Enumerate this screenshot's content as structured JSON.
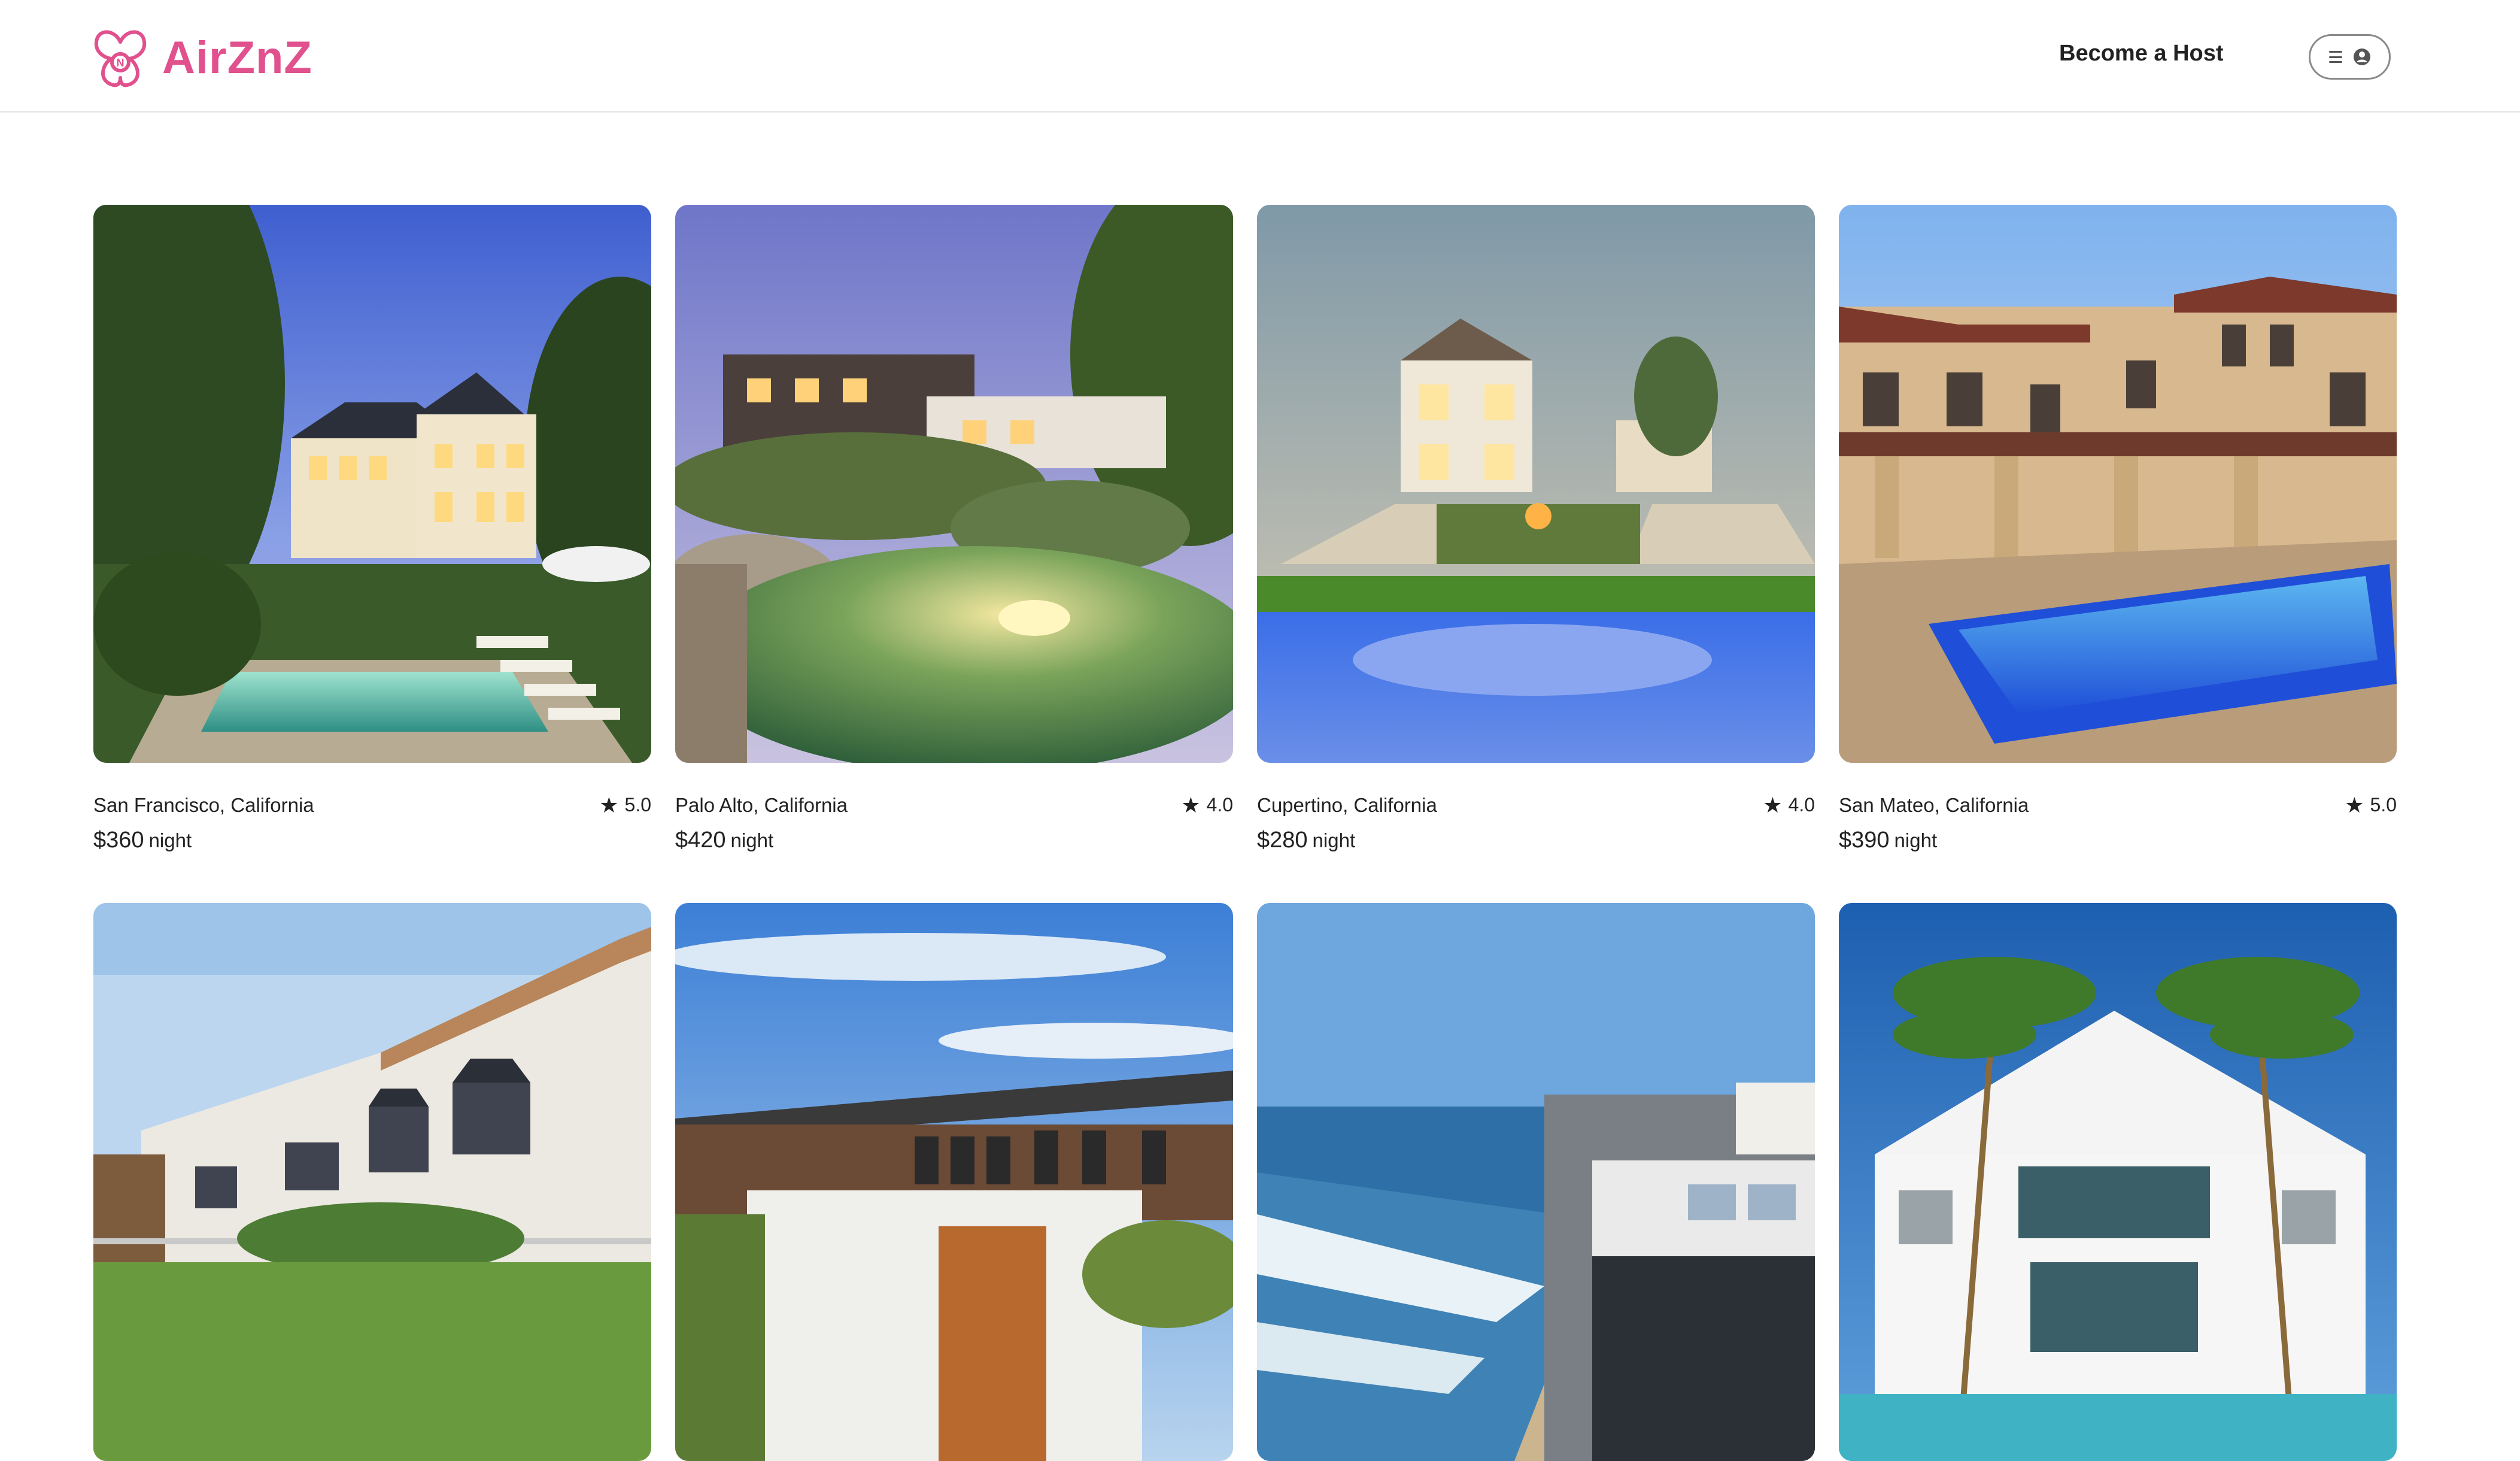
{
  "header": {
    "brand": "AirZnZ",
    "host_link": "Become a Host",
    "colors": {
      "brand": "#e0518d",
      "text": "#222222",
      "border": "#e8e8e8"
    }
  },
  "listings": [
    {
      "location": "San Francisco, California",
      "rating": "5.0",
      "price": "$360",
      "unit": "night",
      "scene": "luxury-house-pool-dusk"
    },
    {
      "location": "Palo Alto, California",
      "rating": "4.0",
      "price": "$420",
      "unit": "night",
      "scene": "garden-lagoon-pool"
    },
    {
      "location": "Cupertino, California",
      "rating": "4.0",
      "price": "$280",
      "unit": "night",
      "scene": "modern-house-lawn-pool"
    },
    {
      "location": "San Mateo, California",
      "rating": "5.0",
      "price": "$390",
      "unit": "night",
      "scene": "stone-villa-pool"
    },
    {
      "scene": "modern-townhouse"
    },
    {
      "scene": "coastal-ranch-house"
    },
    {
      "scene": "beach-houses-ocean"
    },
    {
      "scene": "white-villa-palms"
    }
  ]
}
